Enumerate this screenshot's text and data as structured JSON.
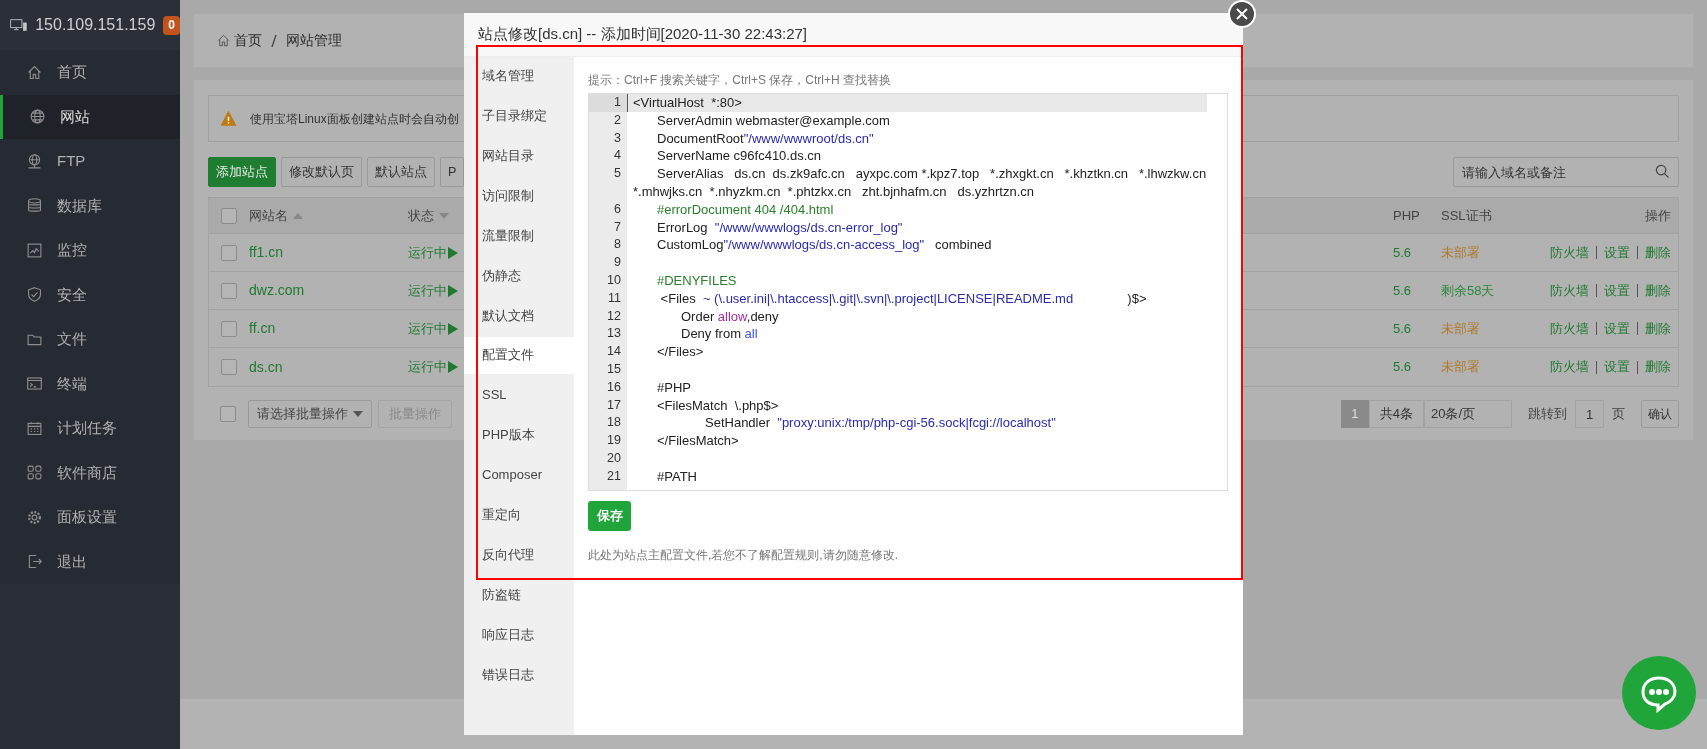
{
  "sidebar": {
    "host": "150.109.151.159",
    "badge": "0",
    "items": [
      {
        "label": "首页",
        "selected": false
      },
      {
        "label": "网站",
        "selected": true
      },
      {
        "label": "FTP",
        "selected": false
      },
      {
        "label": "数据库",
        "selected": false
      },
      {
        "label": "监控",
        "selected": false
      },
      {
        "label": "安全",
        "selected": false
      },
      {
        "label": "文件",
        "selected": false
      },
      {
        "label": "终端",
        "selected": false
      },
      {
        "label": "计划任务",
        "selected": false
      },
      {
        "label": "软件商店",
        "selected": false
      },
      {
        "label": "面板设置",
        "selected": false
      },
      {
        "label": "退出",
        "selected": false
      }
    ]
  },
  "breadcrumb": [
    "首页",
    "网站管理"
  ],
  "notice": "使用宝塔Linux面板创建站点时会自动创",
  "toolbar": {
    "buttons": [
      {
        "label": "添加站点",
        "kind": "primary"
      },
      {
        "label": "修改默认页",
        "kind": "default"
      },
      {
        "label": "默认站点",
        "kind": "default"
      },
      {
        "label": "P",
        "kind": "default"
      }
    ],
    "search": {
      "placeholder": "请输入域名或备注"
    }
  },
  "table": {
    "header_checked": false,
    "columns": [
      {
        "label": "网站名",
        "sort_up": true
      },
      {
        "label": "状态",
        "sort_up": false
      },
      {
        "label": "PHP"
      },
      {
        "label": "SSL证书"
      },
      {
        "label": "操作"
      }
    ],
    "rows": [
      {
        "checked": false,
        "name": "ff1.cn",
        "status": "运行中",
        "php": "5.6",
        "ssl": {
          "text": "未部署",
          "color": "#b07a2a"
        },
        "actions": [
          "防火墙",
          "设置",
          "删除"
        ]
      },
      {
        "checked": false,
        "name": "dwz.com",
        "status": "运行中",
        "php": "5.6",
        "ssl": {
          "text": "剩余58天",
          "color": "#2a8a3a"
        },
        "actions": [
          "防火墙",
          "设置",
          "删除"
        ]
      },
      {
        "checked": false,
        "name": "ff.cn",
        "status": "运行中",
        "php": "5.6",
        "ssl": {
          "text": "未部署",
          "color": "#b07a2a"
        },
        "actions": [
          "防火墙",
          "设置",
          "删除"
        ]
      },
      {
        "checked": false,
        "name": "ds.cn",
        "status": "运行中",
        "php": "5.6",
        "ssl": {
          "text": "未部署",
          "color": "#b07a2a"
        },
        "actions": [
          "防火墙",
          "设置",
          "删除"
        ]
      }
    ]
  },
  "batch": {
    "checked": false,
    "select": "请选择批量操作",
    "button": "批量操作",
    "disabled": true
  },
  "pagination": {
    "pages": [
      {
        "label": "1",
        "selected": true
      }
    ],
    "total": "共4条",
    "per_page": "20条/页",
    "jump_label": "跳转到",
    "jump_value": "1",
    "unit": "页",
    "confirm": "确认"
  },
  "modal": {
    "title": "站点修改[ds.cn] -- 添加时间[2020-11-30 22:43:27]",
    "tabs": [
      {
        "label": "域名管理",
        "selected": false
      },
      {
        "label": "子目录绑定",
        "selected": false
      },
      {
        "label": "网站目录",
        "selected": false
      },
      {
        "label": "访问限制",
        "selected": false
      },
      {
        "label": "流量限制",
        "selected": false
      },
      {
        "label": "伪静态",
        "selected": false
      },
      {
        "label": "默认文档",
        "selected": false
      },
      {
        "label": "配置文件",
        "selected": true
      },
      {
        "label": "SSL",
        "selected": false
      },
      {
        "label": "PHP版本",
        "selected": false
      },
      {
        "label": "Composer",
        "selected": false
      },
      {
        "label": "重定向",
        "selected": false
      },
      {
        "label": "反向代理",
        "selected": false
      },
      {
        "label": "防盗链",
        "selected": false
      },
      {
        "label": "响应日志",
        "selected": false
      },
      {
        "label": "错误日志",
        "selected": false
      }
    ],
    "hint": "提示：Ctrl+F 搜索关键字，Ctrl+S 保存，Ctrl+H 查找替换",
    "editor": {
      "lines": [
        {
          "number": "1",
          "current": true,
          "tokens": [
            {
              "kind": "plain",
              "text": "<VirtualHost  *:80>"
            }
          ]
        },
        {
          "number": "2",
          "current": false,
          "tokens": [
            {
              "kind": "plain",
              "text": "\tServerAdmin webmaster@example.com"
            }
          ]
        },
        {
          "number": "3",
          "current": false,
          "tokens": [
            {
              "kind": "plain",
              "text": "\tDocumentRoot"
            },
            {
              "kind": "string",
              "text": "\"/www/wwwroot/ds.cn\""
            }
          ]
        },
        {
          "number": "4",
          "current": false,
          "tokens": [
            {
              "kind": "plain",
              "text": "\tServerName c96fc410.ds.cn"
            }
          ]
        },
        {
          "number": "5",
          "current": false,
          "tokens": [
            {
              "kind": "plain",
              "text": "\tServerAlias   ds.cn  ds.zk9afc.cn   ayxpc.com *.kpz7.top   *.zhxgkt.cn   *.khztkn.cn   *.lhwzkw.cn   *.mhwjks.cn  *.nhyzkm.cn  *.phtzkx.cn   zht.bjnhafm.cn   ds.yzhrtzn.cn"
            }
          ]
        },
        {
          "number": "6",
          "current": false,
          "tokens": [
            {
              "kind": "comment",
              "text": "\t#errorDocument 404 /404.html"
            }
          ]
        },
        {
          "number": "7",
          "current": false,
          "tokens": [
            {
              "kind": "plain",
              "text": "\tErrorLog  "
            },
            {
              "kind": "string",
              "text": "\"/www/wwwlogs/ds.cn-error_log\""
            }
          ]
        },
        {
          "number": "8",
          "current": false,
          "tokens": [
            {
              "kind": "plain",
              "text": "\tCustomLog"
            },
            {
              "kind": "string",
              "text": "\"/www/wwwlogs/ds.cn-access_log\""
            },
            {
              "kind": "plain",
              "text": "   combined"
            }
          ]
        },
        {
          "number": "9",
          "current": false
        },
        {
          "number": "10",
          "current": false,
          "tokens": [
            {
              "kind": "comment",
              "text": "\t#DENYFILES"
            }
          ]
        },
        {
          "number": "11",
          "current": false,
          "tokens": [
            {
              "kind": "plain",
              "text": "\t <Files  "
            },
            {
              "kind": "string",
              "text": "~ (\\.user.ini|\\.htaccess|\\.git|\\.svn|\\.project|LICENSE|README.md"
            },
            {
              "kind": "plain",
              "text": "               )$>"
            }
          ]
        },
        {
          "number": "12",
          "current": false,
          "tokens": [
            {
              "kind": "plain",
              "text": "\t\tOrder "
            },
            {
              "kind": "keyword",
              "text": "allow"
            },
            {
              "kind": "plain",
              "text": ",deny"
            }
          ]
        },
        {
          "number": "13",
          "current": false,
          "tokens": [
            {
              "kind": "plain",
              "text": "\t\tDeny from "
            },
            {
              "kind": "atom",
              "text": "all"
            }
          ]
        },
        {
          "number": "14",
          "current": false,
          "tokens": [
            {
              "kind": "plain",
              "text": "\t</Files>"
            }
          ]
        },
        {
          "number": "15",
          "current": false
        },
        {
          "number": "16",
          "current": false,
          "tokens": [
            {
              "kind": "plain",
              "text": "\t#PHP"
            }
          ]
        },
        {
          "number": "17",
          "current": false,
          "tokens": [
            {
              "kind": "plain",
              "text": "\t<FilesMatch  \\.php$>"
            }
          ]
        },
        {
          "number": "18",
          "current": false,
          "tokens": [
            {
              "kind": "plain",
              "text": "\t\t\tSetHandler  "
            },
            {
              "kind": "string",
              "text": "\"proxy:unix:/tmp/php-cgi-56.sock|fcgi://localhost\""
            }
          ]
        },
        {
          "number": "19",
          "current": false,
          "tokens": [
            {
              "kind": "plain",
              "text": "\t</FilesMatch>"
            }
          ]
        },
        {
          "number": "20",
          "current": false
        },
        {
          "number": "21",
          "current": false,
          "tokens": [
            {
              "kind": "plain",
              "text": "\t#PATH"
            }
          ]
        }
      ]
    },
    "save": "保存",
    "note": "此处为站点主配置文件,若您不了解配置规则,请勿随意修改."
  }
}
